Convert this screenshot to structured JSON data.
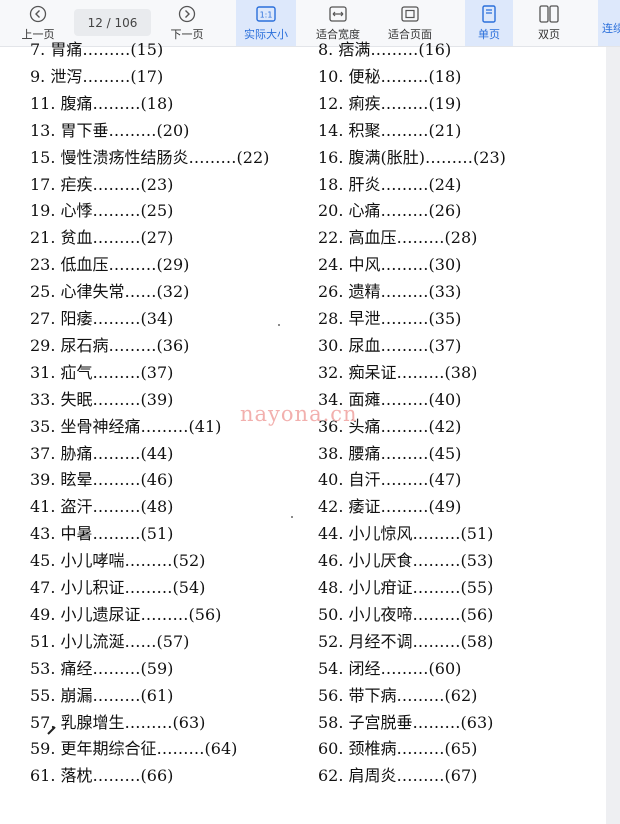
{
  "toolbar": {
    "prev_label": "上一页",
    "page_indicator": "12 / 106",
    "next_label": "下一页",
    "actual_size_label": "实际大小",
    "fit_width_label": "适合宽度",
    "fit_page_label": "适合页面",
    "single_page_label": "单页",
    "double_page_label": "双页",
    "continuous_label": "连续",
    "icons": {
      "prev": "circle-chevron-left-icon",
      "next": "circle-chevron-right-icon",
      "actual_size": "one-to-one-icon",
      "fit_width": "fit-width-icon",
      "fit_page": "fit-page-icon",
      "single_page": "single-page-icon",
      "double_page": "double-page-icon"
    },
    "accent_color": "#2a6fdb"
  },
  "left_column": [
    "7. 胃痛………(15)",
    "9. 泄泻………(17)",
    "11. 腹痛………(18)",
    "13. 胃下垂………(20)",
    "15. 慢性溃疡性结肠炎………(22)",
    "17. 疟疾………(23)",
    "19. 心悸………(25)",
    "21. 贫血………(27)",
    "23. 低血压………(29)",
    "25. 心律失常……(32)",
    "27. 阳痿………(34)",
    "29. 尿石病………(36)",
    "31. 疝气………(37)",
    "33. 失眠………(39)",
    "35. 坐骨神经痛………(41)",
    "37. 胁痛………(44)",
    "39. 眩晕………(46)",
    "41. 盗汗………(48)",
    "43. 中暑………(51)",
    "45. 小儿哮喘………(52)",
    "47. 小儿积证………(54)",
    "49. 小儿遗尿证………(56)",
    "51. 小儿流涎……(57)",
    "53. 痛经………(59)",
    "55. 崩漏………(61)",
    "57. 乳腺增生………(63)",
    "59. 更年期综合征………(64)",
    "61. 落枕………(66)"
  ],
  "right_column": [
    "8. 痞满………(16)",
    "10. 便秘………(18)",
    "12. 痢疾………(19)",
    "14. 积聚………(21)",
    "16. 腹满(胀肚)………(23)",
    "18. 肝炎………(24)",
    "20. 心痛………(26)",
    "22. 高血压………(28)",
    "24. 中风………(30)",
    "26. 遗精………(33)",
    "28. 早泄………(35)",
    "30. 尿血………(37)",
    "32. 痴呆证………(38)",
    "34. 面瘫………(40)",
    "36. 头痛………(42)",
    "38. 腰痛………(45)",
    "40. 自汗………(47)",
    "42. 痿证………(49)",
    "44. 小儿惊风………(51)",
    "46. 小儿厌食………(53)",
    "48. 小儿疳证………(55)",
    "50. 小儿夜啼………(56)",
    "52. 月经不调………(58)",
    "54. 闭经………(60)",
    "56. 带下病………(62)",
    "58. 子宫脱垂………(63)",
    "60. 颈椎病………(65)",
    "62. 肩周炎………(67)"
  ],
  "watermark": "nayona.cn"
}
